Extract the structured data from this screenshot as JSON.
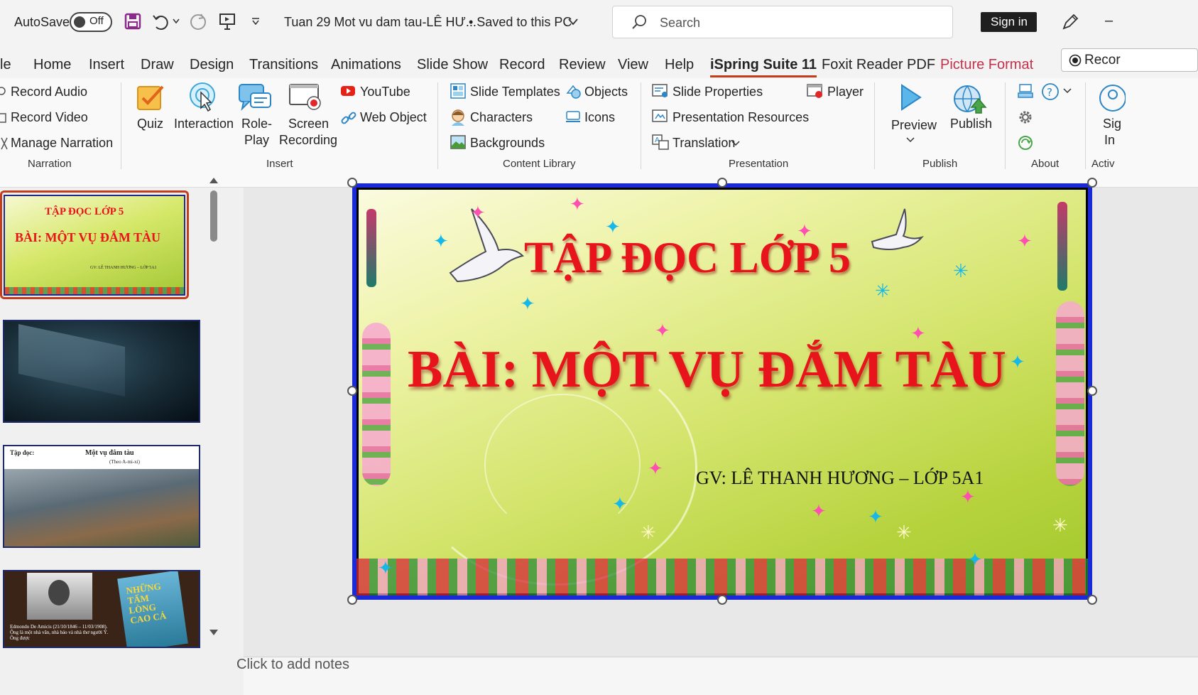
{
  "titlebar": {
    "autosave_label": "AutoSave",
    "autosave_state": "Off",
    "doc_title": "Tuan 29 Mot vu dam tau-LÊ HƯ...",
    "save_status": "• Saved to this PC",
    "search_placeholder": "Search",
    "sign_in": "Sign in"
  },
  "tabs": [
    "le",
    "Home",
    "Insert",
    "Draw",
    "Design",
    "Transitions",
    "Animations",
    "Slide Show",
    "Record",
    "Review",
    "View",
    "Help",
    "iSpring Suite 11",
    "Foxit Reader PDF",
    "Picture Format"
  ],
  "record_button": "Recor",
  "ribbon": {
    "narration": {
      "items": [
        "Record Audio",
        "Record Video",
        "Manage Narration"
      ],
      "group_label": "Narration"
    },
    "insert": {
      "quiz": "Quiz",
      "interaction": "Interaction",
      "roleplay": "Role-\nPlay",
      "roleplay_1": "Role-",
      "roleplay_2": "Play",
      "screen_1": "Screen",
      "screen_2": "Recording",
      "youtube": "YouTube",
      "web_object": "Web Object",
      "group_label": "Insert"
    },
    "content_library": {
      "slide_templates": "Slide Templates",
      "characters": "Characters",
      "backgrounds": "Backgrounds",
      "objects": "Objects",
      "icons": "Icons",
      "group_label": "Content Library"
    },
    "presentation": {
      "slide_properties": "Slide Properties",
      "presentation_resources": "Presentation Resources",
      "translation": "Translation",
      "player": "Player",
      "group_label": "Presentation"
    },
    "publish": {
      "preview": "Preview",
      "publish": "Publish",
      "group_label": "Publish"
    },
    "about": {
      "group_label": "About"
    },
    "partial": {
      "label_1": "Sig",
      "label_2": "In",
      "group_label": "Activ"
    }
  },
  "slide": {
    "title": "TẬP ĐỌC LỚP 5",
    "heading": "BÀI: MỘT VỤ ĐẮM TÀU",
    "teacher": "GV: LÊ THANH HƯƠNG – LỚP 5A1"
  },
  "thumbnails": {
    "t1_title": "TẬP ĐỌC LỚP 5",
    "t1_heading": "BÀI: MỘT VỤ ĐẮM TÀU",
    "t1_teacher": "GV: LÊ THANH HƯƠNG – LỚP 5A1",
    "t3_label": "Tập đọc:",
    "t3_title": "Một vụ đắm tàu",
    "t3_sub": "(Theo A-mi-xi)",
    "t4_caption": "Edmondo De Amicis (21/10/1846 – 11/03/1908). Ông là một nhà văn, nhà báo và nhà thơ người Ý. Ông được",
    "t4_book": "NHỮNG TẤM LÒNG CAO CẢ"
  },
  "notes_placeholder": "Click to add notes",
  "colors": {
    "accent": "#c43e1c",
    "slide_red": "#e8141c",
    "picture_format": "#c4314b"
  }
}
